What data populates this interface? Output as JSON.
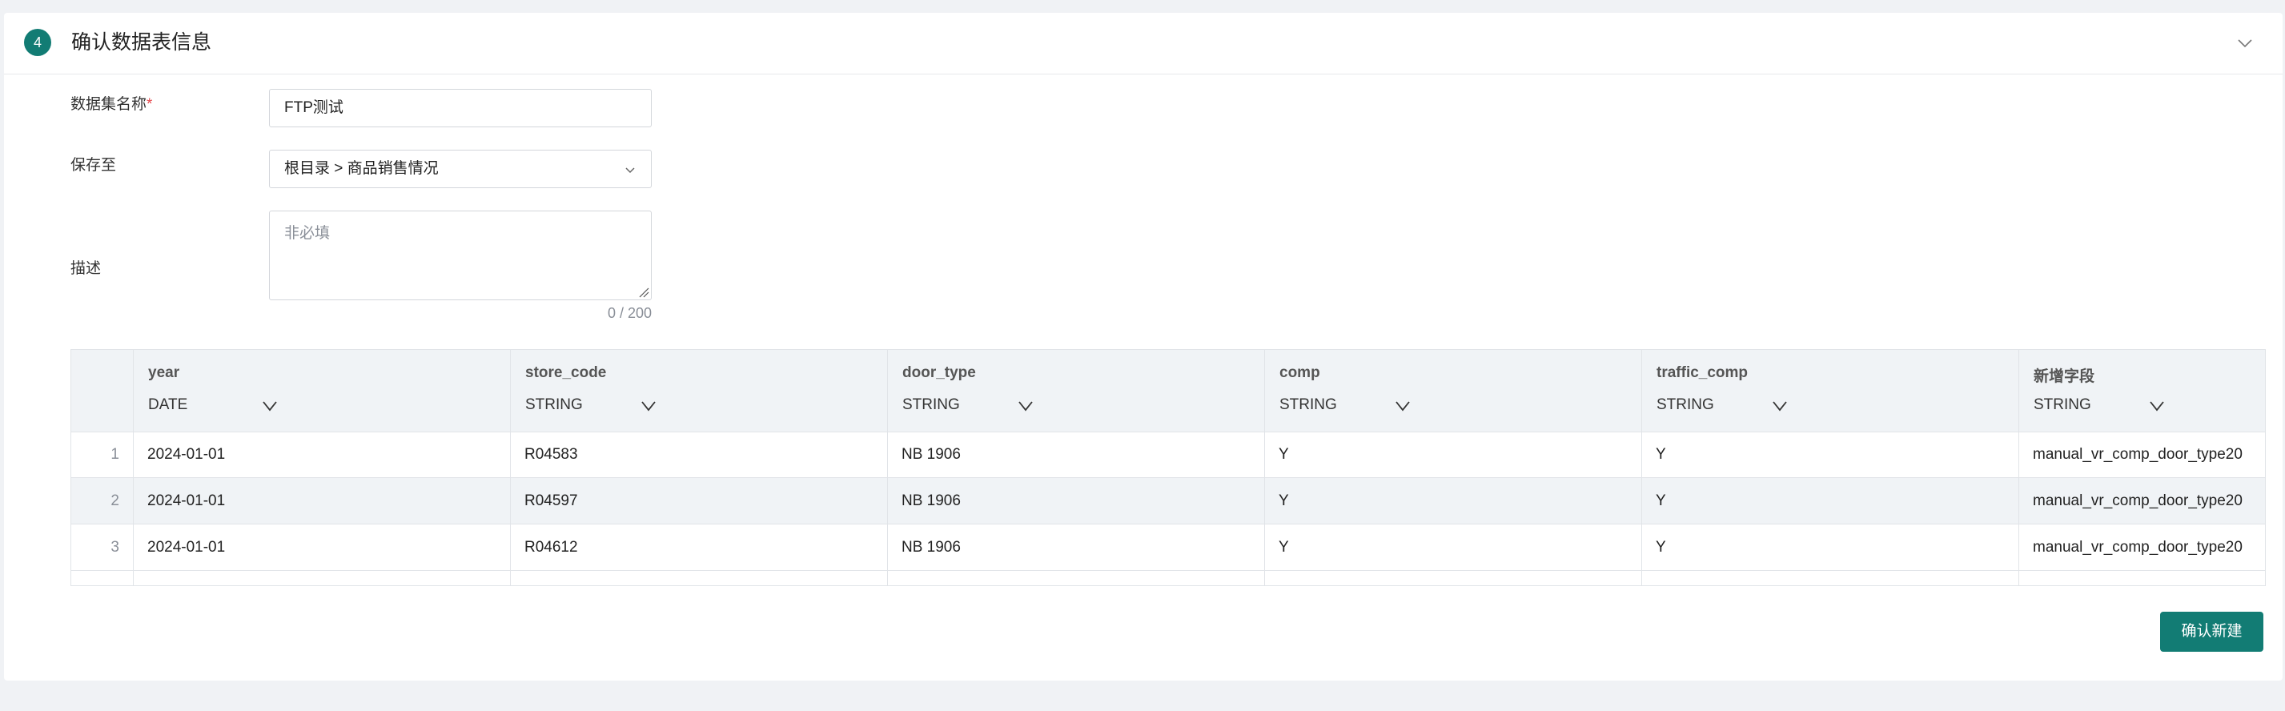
{
  "section": {
    "step_number": "4",
    "title": "确认数据表信息"
  },
  "form": {
    "name_label": "数据集名称",
    "name_required_mark": "*",
    "name_value": "FTP测试",
    "save_to_label": "保存至",
    "save_to_value": "根目录 > 商品销售情况",
    "description_label": "描述",
    "description_placeholder": "非必填",
    "description_counter": "0 / 200"
  },
  "table": {
    "columns": [
      {
        "name": "year",
        "type": "DATE"
      },
      {
        "name": "store_code",
        "type": "STRING"
      },
      {
        "name": "door_type",
        "type": "STRING"
      },
      {
        "name": "comp",
        "type": "STRING"
      },
      {
        "name": "traffic_comp",
        "type": "STRING"
      },
      {
        "name": "新增字段",
        "type": "STRING"
      }
    ],
    "rows": [
      {
        "index": "1",
        "cells": [
          "2024-01-01",
          "R04583",
          "NB 1906",
          "Y",
          "Y",
          "manual_vr_comp_door_type20"
        ]
      },
      {
        "index": "2",
        "cells": [
          "2024-01-01",
          "R04597",
          "NB 1906",
          "Y",
          "Y",
          "manual_vr_comp_door_type20"
        ]
      },
      {
        "index": "3",
        "cells": [
          "2024-01-01",
          "R04612",
          "NB 1906",
          "Y",
          "Y",
          "manual_vr_comp_door_type20"
        ]
      }
    ]
  },
  "actions": {
    "confirm_label": "确认新建"
  },
  "colors": {
    "accent": "#127c74",
    "required": "#e5484d",
    "header_bg": "#f0f3f6"
  }
}
